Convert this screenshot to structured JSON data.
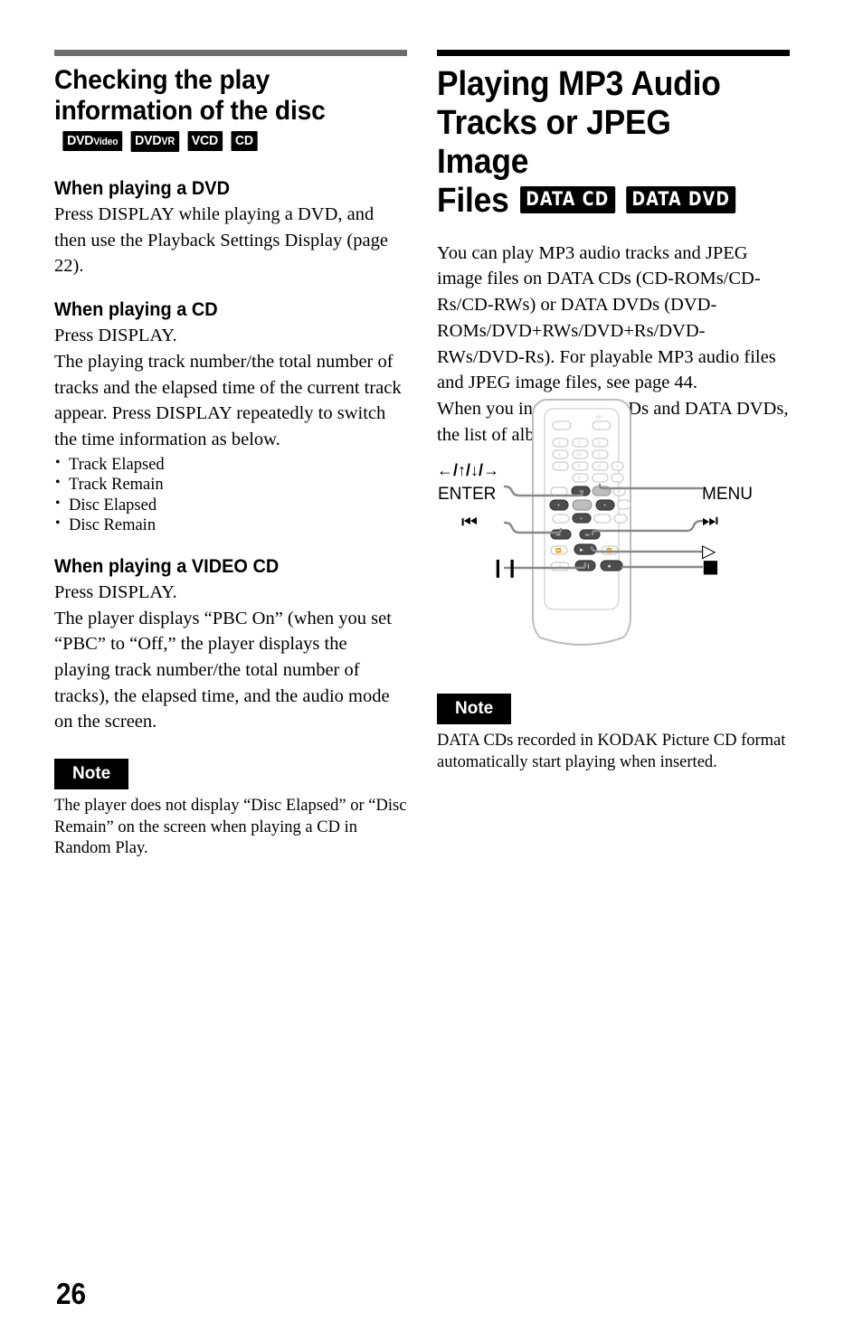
{
  "page": {
    "number": "26"
  },
  "left_column": {
    "rule_color": "#6e6e6e",
    "heading": "Checking the play information of the disc",
    "heading_badges": [
      {
        "name": "dvd-video-badge",
        "main": "DVD",
        "sub": "Video"
      },
      {
        "name": "dvd-vr-badge",
        "main": "DVD",
        "sub": "VR"
      },
      {
        "name": "vcd-badge",
        "main": "VCD",
        "sub": ""
      },
      {
        "name": "cd-badge",
        "main": "CD",
        "sub": ""
      }
    ],
    "sections": [
      {
        "heading": "When playing a DVD",
        "body": "Press DISPLAY while playing a DVD, and then use the Playback Settings Display (page 22)."
      },
      {
        "heading": "When playing a CD",
        "body_1": "Press DISPLAY.",
        "body_2": "The playing track number/the total number of tracks and the elapsed time of the current track appear. Press DISPLAY repeatedly to switch the time information as below.",
        "bullets": [
          "Track Elapsed",
          "Track Remain",
          "Disc Elapsed",
          "Disc Remain"
        ]
      },
      {
        "heading": "When playing a VIDEO CD",
        "body_1": "Press DISPLAY.",
        "body_2": "The player displays “PBC On” (when you set “PBC” to “Off,” the player displays the playing track number/the total number of tracks), the elapsed time, and the audio mode on the screen."
      }
    ],
    "note": {
      "label": "Note",
      "text": "The player does not display “Disc Elapsed” or “Disc Remain” on the screen when playing a CD in Random Play."
    }
  },
  "right_column": {
    "rule_color": "#000000",
    "heading_line_1": "Playing MP3 Audio",
    "heading_line_2": "Tracks or JPEG Image",
    "heading_line_3": "Files",
    "heading_badges": [
      {
        "name": "data-cd-badge",
        "label": "DATA CD"
      },
      {
        "name": "data-dvd-badge",
        "label": "DATA DVD"
      }
    ],
    "body": "You can play MP3 audio tracks and JPEG image files on DATA CDs  (CD-ROMs/CD-Rs/CD-RWs) or DATA DVDs (DVD-ROMs/DVD+RWs/DVD+Rs/DVD-RWs/DVD-Rs). For playable MP3 audio files and JPEG image files, see page 44.",
    "body_2": "When you insert DATA CDs and DATA DVDs, the list of albums appears.",
    "note": {
      "label": "Note",
      "text": "DATA CDs recorded in KODAK Picture CD format automatically start playing when inserted."
    }
  },
  "figure": {
    "name": "remote-control-diagram",
    "callouts": {
      "arrows": "←/↑/↓/→",
      "enter": "ENTER",
      "menu": "MENU",
      "prev": "⏮",
      "next": "⏭",
      "play": "▷",
      "pause": "❙❙",
      "stop": "■"
    },
    "keypad_digits": [
      "1",
      "2",
      "3",
      "4",
      "5+",
      "6",
      "7",
      "8",
      "9",
      "0"
    ],
    "power_symbol": "I/⏻"
  }
}
